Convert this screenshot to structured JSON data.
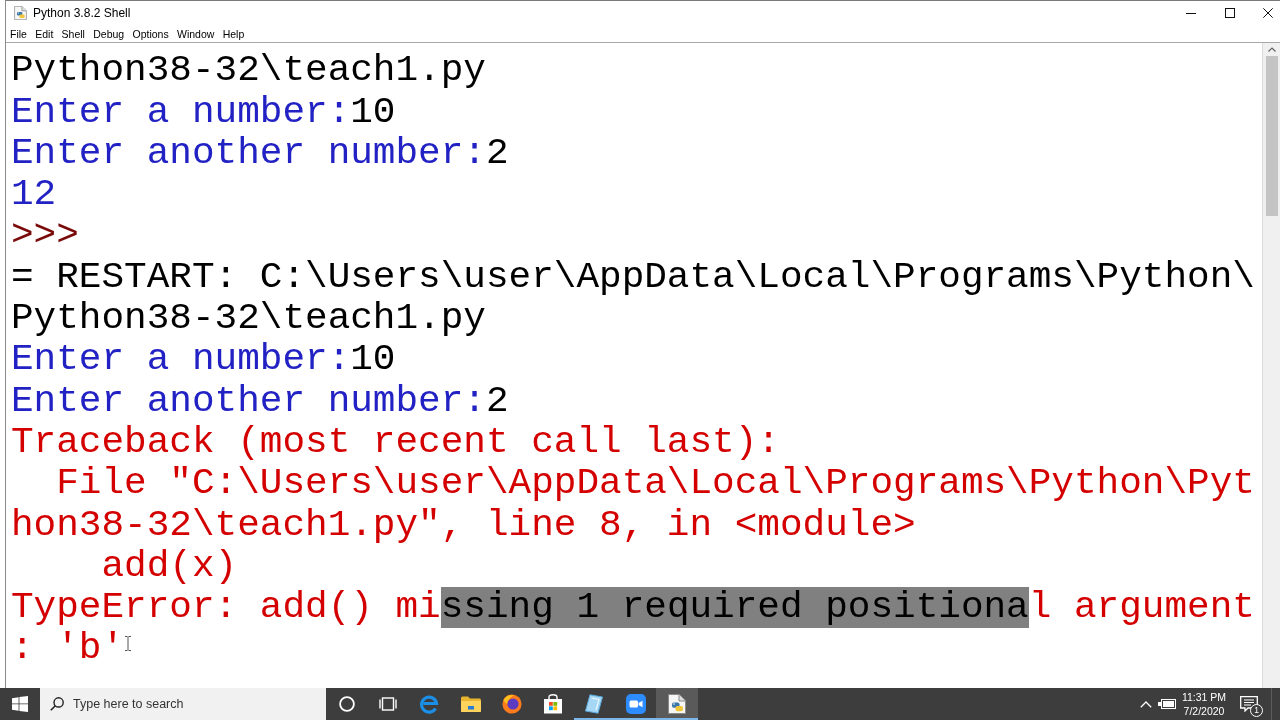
{
  "window": {
    "title": "Python 3.8.2 Shell"
  },
  "menu": [
    "File",
    "Edit",
    "Shell",
    "Debug",
    "Options",
    "Window",
    "Help"
  ],
  "shell": {
    "lines": [
      {
        "segments": [
          {
            "text": "Python38-32\\teach1.py",
            "kind": "console",
            "selected": false
          }
        ]
      },
      {
        "segments": [
          {
            "text": "Enter a number:",
            "kind": "stdout",
            "selected": false
          },
          {
            "text": "10",
            "kind": "stdin",
            "selected": false
          }
        ]
      },
      {
        "segments": [
          {
            "text": "Enter another number:",
            "kind": "stdout",
            "selected": false
          },
          {
            "text": "2",
            "kind": "stdin",
            "selected": false
          }
        ]
      },
      {
        "segments": [
          {
            "text": "12",
            "kind": "stdout",
            "selected": false
          }
        ]
      },
      {
        "segments": [
          {
            "text": ">>>",
            "kind": "prompt",
            "selected": false
          }
        ]
      },
      {
        "segments": [
          {
            "text": "= RESTART: C:\\Users\\user\\AppData\\Local\\Programs\\Python\\",
            "kind": "console",
            "selected": false
          }
        ]
      },
      {
        "segments": [
          {
            "text": "Python38-32\\teach1.py",
            "kind": "console",
            "selected": false
          }
        ]
      },
      {
        "segments": [
          {
            "text": "Enter a number:",
            "kind": "stdout",
            "selected": false
          },
          {
            "text": "10",
            "kind": "stdin",
            "selected": false
          }
        ]
      },
      {
        "segments": [
          {
            "text": "Enter another number:",
            "kind": "stdout",
            "selected": false
          },
          {
            "text": "2",
            "kind": "stdin",
            "selected": false
          }
        ]
      },
      {
        "segments": [
          {
            "text": "Traceback (most recent call last):",
            "kind": "stderr",
            "selected": false
          }
        ]
      },
      {
        "segments": [
          {
            "text": "  File \"C:\\Users\\user\\AppData\\Local\\Programs\\Python\\Pyt",
            "kind": "stderr",
            "selected": false
          }
        ]
      },
      {
        "segments": [
          {
            "text": "hon38-32\\teach1.py\", line 8, in <module>",
            "kind": "stderr",
            "selected": false
          }
        ]
      },
      {
        "segments": [
          {
            "text": "    add(x)",
            "kind": "stderr",
            "selected": false
          }
        ]
      },
      {
        "segments": [
          {
            "text": "TypeError: add() mi",
            "kind": "stderr",
            "selected": false
          },
          {
            "text": "ssing 1 required positiona",
            "kind": "stderr",
            "selected": true
          },
          {
            "text": "l argument",
            "kind": "stderr",
            "selected": false
          }
        ]
      },
      {
        "segments": [
          {
            "text": ": 'b'",
            "kind": "stderr",
            "selected": false
          }
        ]
      }
    ]
  },
  "taskbar": {
    "search": {
      "placeholder": "Type here to search"
    },
    "apps": [
      {
        "kind": "edge",
        "open": false,
        "selected": false
      },
      {
        "kind": "folder",
        "open": false,
        "selected": false
      },
      {
        "kind": "firefox",
        "open": false,
        "selected": false
      },
      {
        "kind": "store",
        "open": false,
        "selected": false
      },
      {
        "kind": "sheet",
        "open": true,
        "selected": false
      },
      {
        "kind": "camera",
        "open": true,
        "selected": false
      },
      {
        "kind": "python",
        "open": true,
        "selected": true
      }
    ],
    "clock": {
      "time": "11:31 PM",
      "date": "7/2/2020"
    },
    "notifications": {
      "count": "1"
    }
  }
}
